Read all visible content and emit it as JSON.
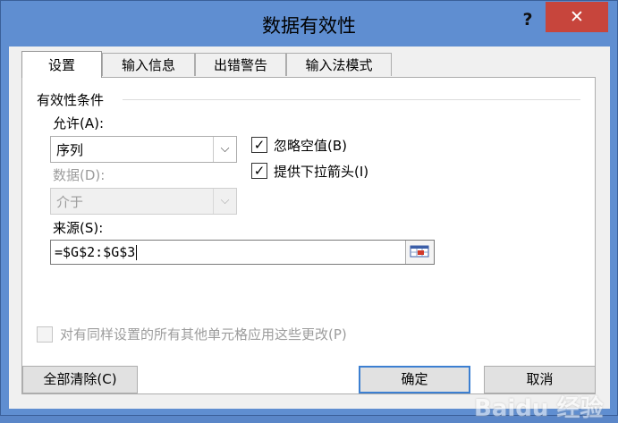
{
  "window": {
    "title": "数据有效性",
    "help_label": "?",
    "close_label": "✕"
  },
  "tabs": [
    {
      "label": "设置",
      "active": true
    },
    {
      "label": "输入信息",
      "active": false
    },
    {
      "label": "出错警告",
      "active": false
    },
    {
      "label": "输入法模式",
      "active": false
    }
  ],
  "settings": {
    "group_title": "有效性条件",
    "allow": {
      "label": "允许(A):",
      "value": "序列"
    },
    "data": {
      "label": "数据(D):",
      "value": "介于",
      "enabled": false
    },
    "ignore_blank": {
      "label": "忽略空值(B)",
      "checked": true
    },
    "dropdown": {
      "label": "提供下拉箭头(I)",
      "checked": true
    },
    "source": {
      "label": "来源(S):",
      "value": "=$G$2:$G$3"
    },
    "apply_all": {
      "label": "对有同样设置的所有其他单元格应用这些更改(P)",
      "checked": false,
      "enabled": false
    }
  },
  "buttons": {
    "clear_all": "全部清除(C)",
    "ok": "确定",
    "cancel": "取消"
  },
  "watermark": "Baidu 经验"
}
